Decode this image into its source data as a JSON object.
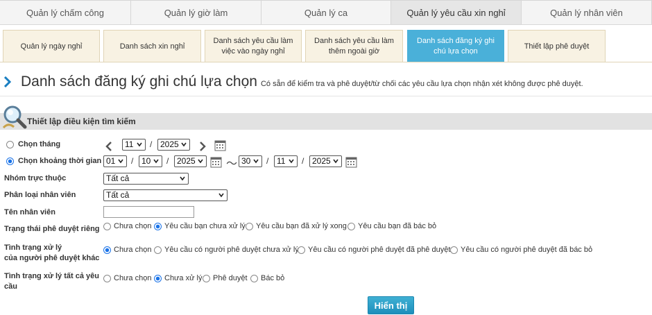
{
  "top_tabs": [
    {
      "label": "Quản lý chấm công"
    },
    {
      "label": "Quản lý giờ làm"
    },
    {
      "label": "Quản lý ca"
    },
    {
      "label": "Quản lý yêu cầu xin nghỉ"
    },
    {
      "label": "Quản lý nhân viên"
    }
  ],
  "sub_tabs": [
    {
      "label": "Quản lý ngày nghỉ"
    },
    {
      "label": "Danh sách xin nghỉ"
    },
    {
      "label": "Danh sách yêu cầu làm việc vào ngày nghỉ"
    },
    {
      "label": "Danh sách yêu cầu làm thêm ngoài giờ"
    },
    {
      "label": "Danh sách đăng ký ghi chú lựa chọn"
    },
    {
      "label": "Thiết lập phê duyệt"
    }
  ],
  "page": {
    "title": "Danh sách đăng ký ghi chú lựa chọn",
    "description": "Có sẵn để kiểm tra và phê duyệt/từ chối các yêu cầu lựa chọn nhận xét không được phê duyệt."
  },
  "search": {
    "title": "Thiết lập điều kiện tìm kiếm",
    "month_label": "Chọn tháng",
    "month": "11",
    "year": "2025",
    "period_label": "Chọn khoảng thời gian",
    "from_day": "01",
    "from_month": "10",
    "from_year": "2025",
    "to_day": "30",
    "to_month": "11",
    "to_year": "2025",
    "group_label": "Nhóm trực thuộc",
    "group_value": "Tất cả",
    "category_label": "Phân loại nhân viên",
    "category_value": "Tất cả",
    "name_label": "Tên nhân viên",
    "name_value": "",
    "own_status_label": "Trạng thái phê duyệt riêng",
    "own_status_options": [
      "Chưa chọn",
      "Yêu cầu bạn chưa xử lý",
      "Yêu cầu bạn đã xử lý xong",
      "Yêu cầu bạn đã bác bỏ"
    ],
    "other_status_label_1": "Tình trạng xử lý",
    "other_status_label_2": "của người phê duyệt khác",
    "other_status_options": [
      "Chưa chọn",
      "Yêu cầu có người phê duyệt chưa xử lý",
      "Yêu cầu có người phê duyệt đã phê duyệt",
      "Yêu cầu có người phê duyệt đã bác bỏ"
    ],
    "all_status_label_1": "Tình trạng xử lý tất cả yêu",
    "all_status_label_2": "cầu",
    "all_status_options": [
      "Chưa chọn",
      "Chưa xử lý",
      "Phê duyệt",
      "Bác bỏ"
    ],
    "submit_label": "Hiển thị",
    "slash": "/",
    "tilde": "～"
  },
  "colors": {
    "accent": "#4ab0d9",
    "button": "#2aa0c8",
    "header_bg": "#e2e2e2"
  }
}
